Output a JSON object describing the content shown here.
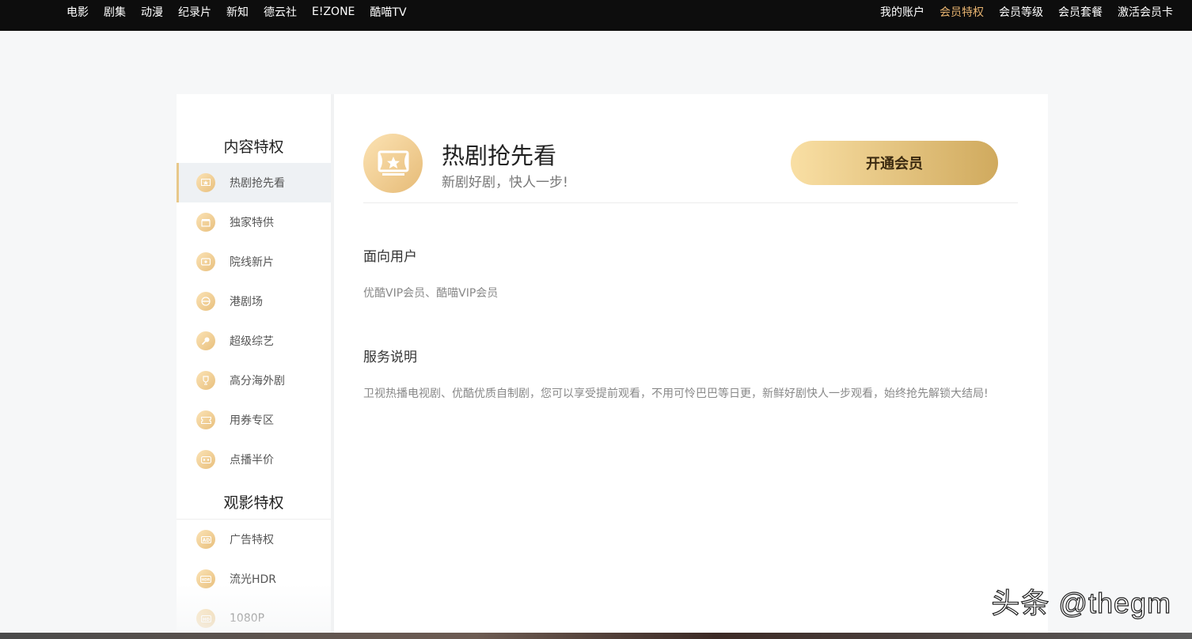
{
  "topnav": {
    "left": [
      "电影",
      "剧集",
      "动漫",
      "纪录片",
      "新知",
      "德云社",
      "E!ZONE",
      "酷喵TV"
    ],
    "right": [
      {
        "label": "我的账户",
        "active": false
      },
      {
        "label": "会员特权",
        "active": true
      },
      {
        "label": "会员等级",
        "active": false
      },
      {
        "label": "会员套餐",
        "active": false
      },
      {
        "label": "激活会员卡",
        "active": false
      }
    ]
  },
  "sidebar": {
    "group1_title": "内容特权",
    "group1_items": [
      {
        "label": "热剧抢先看",
        "icon": "theater-icon",
        "active": true
      },
      {
        "label": "独家特供",
        "icon": "clapper-icon",
        "active": false
      },
      {
        "label": "院线新片",
        "icon": "tv-icon",
        "active": false
      },
      {
        "label": "港剧场",
        "icon": "stage-icon",
        "active": false
      },
      {
        "label": "超级综艺",
        "icon": "microphone-icon",
        "active": false
      },
      {
        "label": "高分海外剧",
        "icon": "trophy-icon",
        "active": false
      },
      {
        "label": "用券专区",
        "icon": "ticket-icon",
        "active": false
      },
      {
        "label": "点播半价",
        "icon": "discount-icon",
        "active": false
      }
    ],
    "group2_title": "观影特权",
    "group2_items": [
      {
        "label": "广告特权",
        "icon": "ad-icon",
        "active": false
      },
      {
        "label": "流光HDR",
        "icon": "hdr-icon",
        "active": false
      },
      {
        "label": "1080P",
        "icon": "hd-icon",
        "active": false
      }
    ]
  },
  "main": {
    "title": "热剧抢先看",
    "subtitle": "新剧好剧，快人一步!",
    "open_button": "开通会员",
    "section1_title": "面向用户",
    "section1_text": "优酷VIP会员、酷喵VIP会员",
    "section2_title": "服务说明",
    "section2_text": "卫视热播电视剧、优酷优质自制剧，您可以享受提前观看，不用可怜巴巴等日更，新鲜好剧快人一步观看，始终抢先解锁大结局!"
  },
  "watermark": "头条 @thegm",
  "colors": {
    "accent": "#e8b470",
    "topbar": "#0d0d0d",
    "button_start": "#f9dfa4",
    "button_end": "#d0aa5e"
  }
}
